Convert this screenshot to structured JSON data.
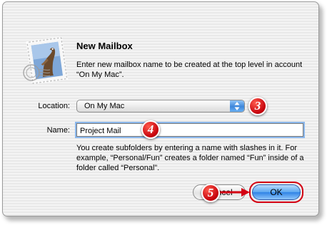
{
  "dialog": {
    "title": "New Mailbox",
    "description": "Enter new mailbox name to be created at the top level in account “On My Mac”."
  },
  "location": {
    "label": "Location:",
    "selected": "On My Mac"
  },
  "name": {
    "label": "Name:",
    "value": "Project Mail"
  },
  "hint": "You create subfolders by entering a name with slashes in it. For example, “Personal/Fun” creates a folder named “Fun” inside of a folder called “Personal”.",
  "buttons": {
    "cancel": "Cancel",
    "ok": "OK"
  },
  "callouts": {
    "step3": "3",
    "step4": "4",
    "step5": "5"
  },
  "colors": {
    "callout_red": "#d40012",
    "ok_blue": "#2f83e6",
    "focus_ring": "#8cb8ec"
  },
  "icons": {
    "mail": "mail-stamp-eagle-icon",
    "popup_arrows": "up-down-arrows-icon"
  }
}
